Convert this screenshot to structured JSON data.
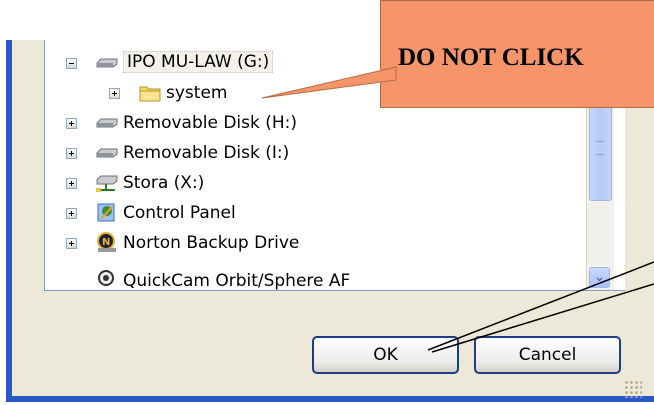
{
  "tree": {
    "items": [
      {
        "label": "IPO MU-LAW (G:)",
        "expander": "minus",
        "icon": "drive-icon",
        "selected": true
      },
      {
        "label": "system",
        "expander": "plus",
        "icon": "folder-icon"
      },
      {
        "label": "Removable Disk (H:)",
        "expander": "plus",
        "icon": "drive-icon"
      },
      {
        "label": "Removable Disk (I:)",
        "expander": "plus",
        "icon": "drive-icon"
      },
      {
        "label": "Stora (X:)",
        "expander": "plus",
        "icon": "network-drive-icon"
      },
      {
        "label": "Control Panel",
        "expander": "plus",
        "icon": "control-panel-icon"
      },
      {
        "label": "Norton Backup Drive",
        "expander": "plus",
        "icon": "norton-icon"
      },
      {
        "label": "QuickCam Orbit/Sphere AF",
        "expander": "none",
        "icon": "webcam-icon"
      }
    ]
  },
  "buttons": {
    "ok": "OK",
    "cancel": "Cancel"
  },
  "annotation": {
    "callout_text": "DO NOT CLICK"
  },
  "colors": {
    "callout_fill": "#f7956a",
    "window_frame": "#2a58c8",
    "dialog_face": "#ece9d8"
  }
}
